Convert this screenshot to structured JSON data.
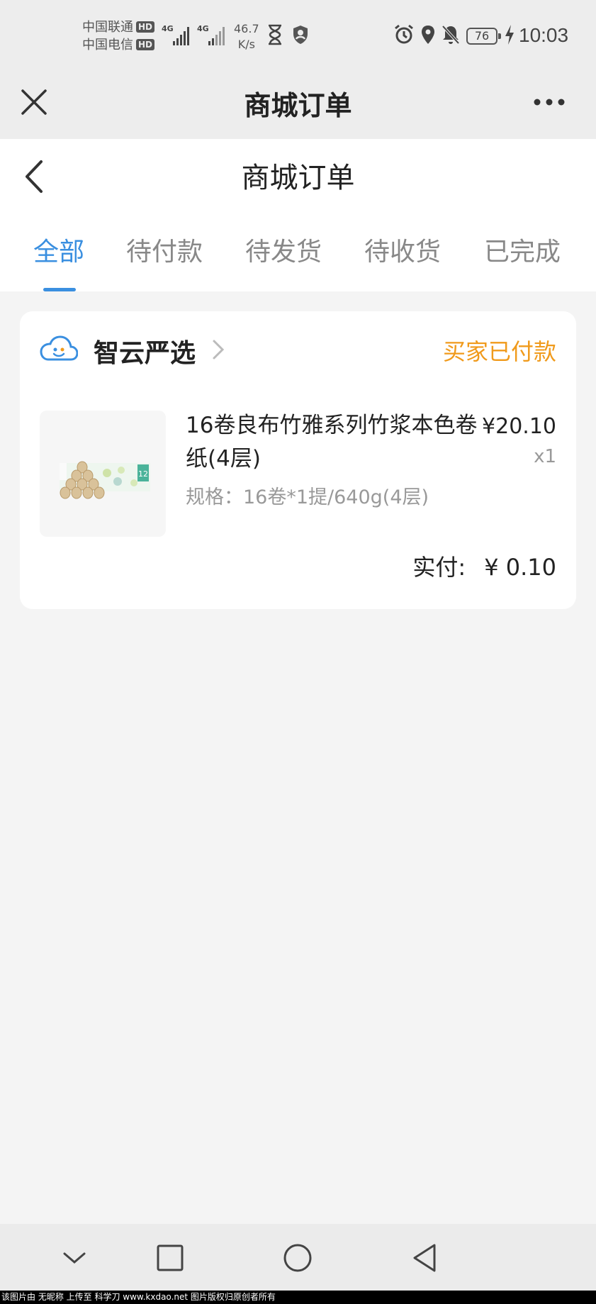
{
  "status_bar": {
    "carrier1": "中国联通",
    "carrier2": "中国电信",
    "hd": "HD",
    "network1": "4G",
    "network2": "4G",
    "speed_value": "46.7",
    "speed_unit": "K/s",
    "battery": "76",
    "time": "10:03"
  },
  "miniprogram_header": {
    "title": "商城订单"
  },
  "page_header": {
    "title": "商城订单"
  },
  "tabs": [
    {
      "label": "全部",
      "active": true
    },
    {
      "label": "待付款",
      "active": false
    },
    {
      "label": "待发货",
      "active": false
    },
    {
      "label": "待收货",
      "active": false
    },
    {
      "label": "已完成",
      "active": false
    }
  ],
  "order": {
    "shop_name": "智云严选",
    "status": "买家已付款",
    "product": {
      "title": "16卷良布竹雅系列竹浆本色卷纸(4层)",
      "spec": "规格：16卷*1提/640g(4层)",
      "price": "¥20.10",
      "quantity": "x1",
      "image_label": "12"
    },
    "paid_label": "实付:",
    "paid_amount": "¥ 0.10"
  },
  "watermark": "该图片由 无昵称 上传至 科学刀 www.kxdao.net 图片版权归原创者所有",
  "colors": {
    "accent": "#3a8fe0",
    "status": "#f09a1b",
    "background": "#f4f4f4"
  }
}
